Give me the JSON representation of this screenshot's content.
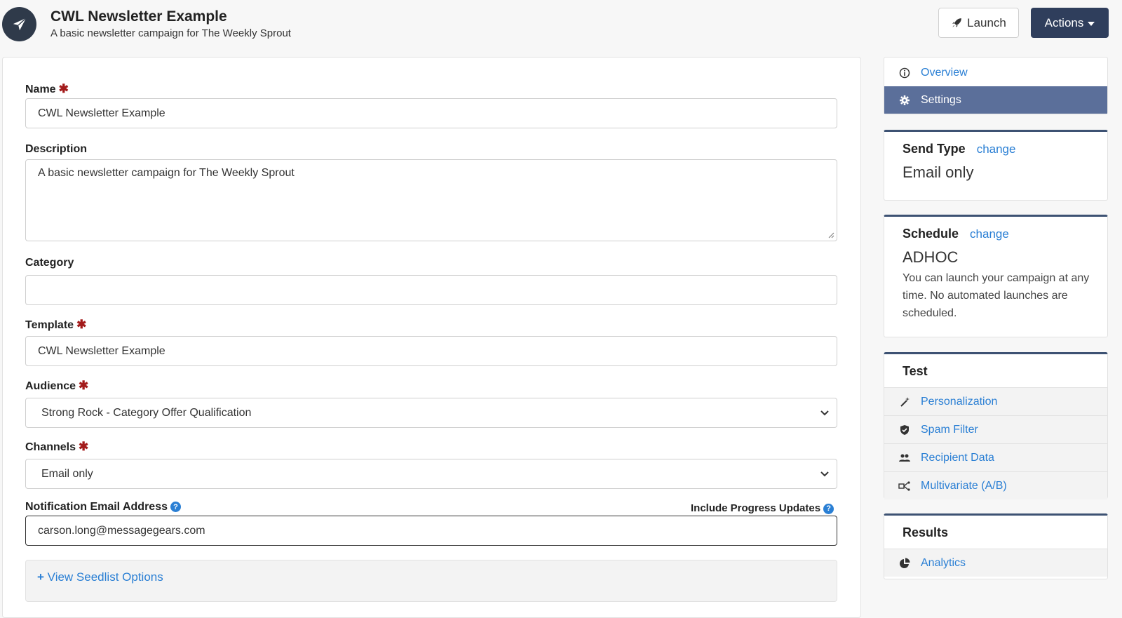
{
  "header": {
    "title": "CWL Newsletter Example",
    "subtitle": "A basic newsletter campaign for The Weekly Sprout",
    "launch_label": "Launch",
    "actions_label": "Actions"
  },
  "form": {
    "name": {
      "label": "Name",
      "value": "CWL Newsletter Example",
      "required": true
    },
    "description": {
      "label": "Description",
      "value": "A basic newsletter campaign for The Weekly Sprout"
    },
    "category": {
      "label": "Category",
      "value": ""
    },
    "template": {
      "label": "Template",
      "value": "CWL Newsletter Example",
      "required": true
    },
    "audience": {
      "label": "Audience",
      "value": "Strong Rock - Category Offer Qualification",
      "required": true
    },
    "channels": {
      "label": "Channels",
      "value": "Email only",
      "required": true
    },
    "notification": {
      "label": "Notification Email Address",
      "value": "carson.long@messagegears.com",
      "progress_label": "Include Progress Updates",
      "progress_checked": false
    },
    "seedlist_label": "View Seedlist Options",
    "required_mark": "✱"
  },
  "sidebar": {
    "nav": [
      {
        "label": "Overview",
        "icon": "info-icon",
        "active": false
      },
      {
        "label": "Settings",
        "icon": "gear-icon",
        "active": true
      }
    ],
    "send_type": {
      "heading": "Send Type",
      "link": "change",
      "value": "Email only"
    },
    "schedule": {
      "heading": "Schedule",
      "link": "change",
      "value": "ADHOC",
      "description": "You can launch your campaign at any time. No automated launches are scheduled."
    },
    "test": {
      "heading": "Test",
      "items": [
        {
          "label": "Personalization",
          "icon": "magic-wand-icon"
        },
        {
          "label": "Spam Filter",
          "icon": "shield-icon"
        },
        {
          "label": "Recipient Data",
          "icon": "users-icon"
        },
        {
          "label": "Multivariate (A/B)",
          "icon": "split-icon"
        }
      ]
    },
    "results": {
      "heading": "Results",
      "items": [
        {
          "label": "Analytics",
          "icon": "pie-chart-icon"
        }
      ]
    }
  },
  "colors": {
    "accent": "#2a7fd4",
    "primary_button": "#2f3e5c",
    "active_nav": "#5b6f9a",
    "required": "#a31b1b"
  }
}
